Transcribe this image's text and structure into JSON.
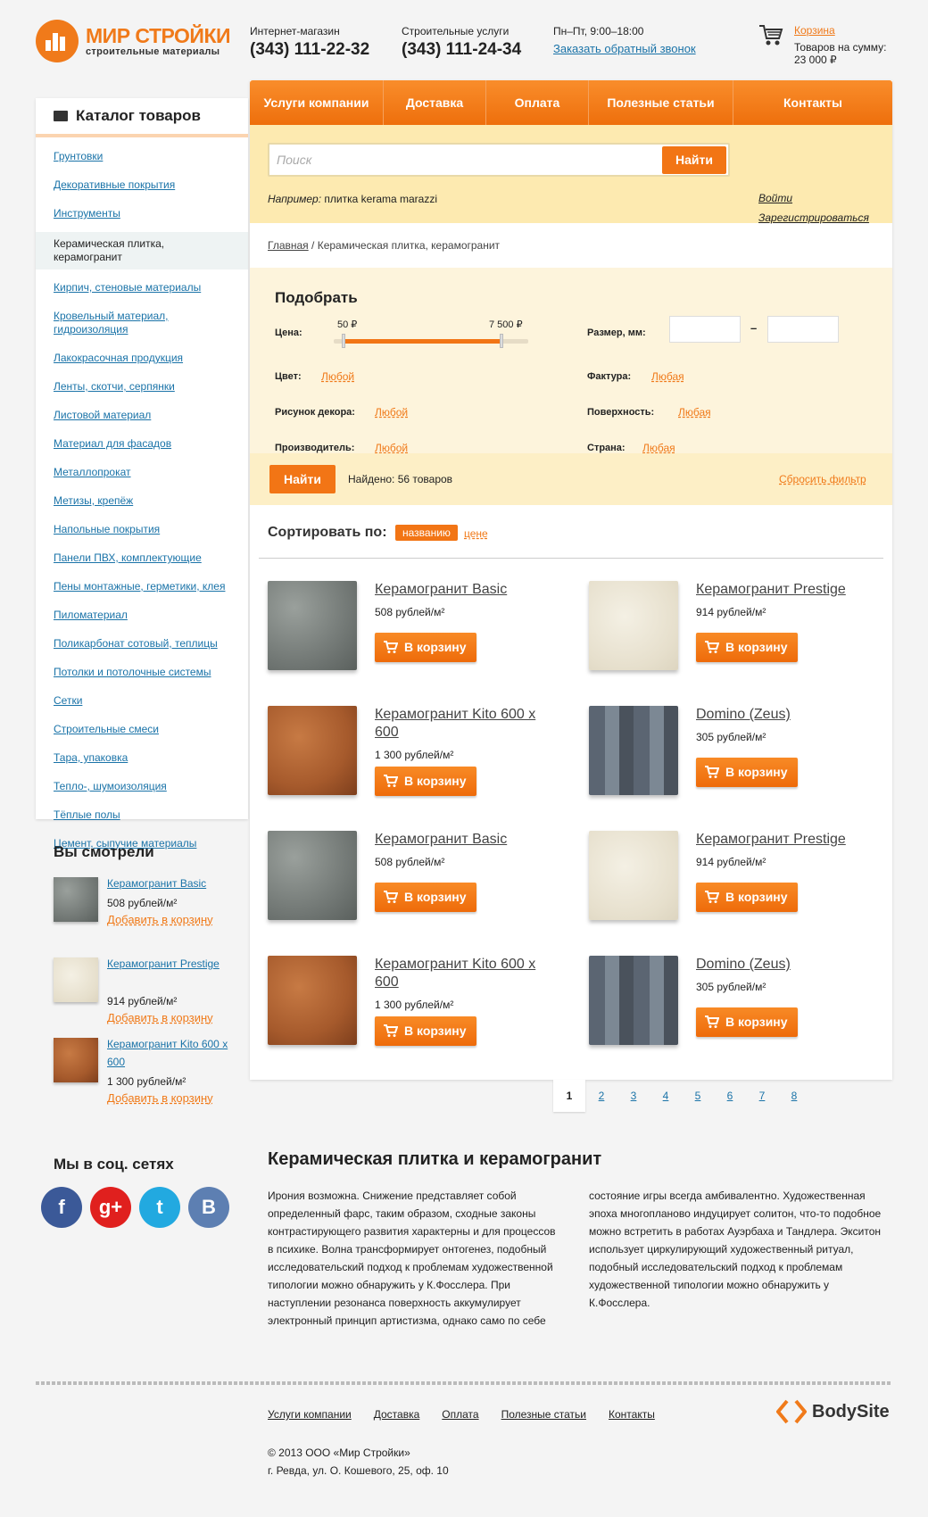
{
  "brand": {
    "title": "МИР СТРОЙКИ",
    "subtitle": "строительные материалы",
    "accent": "#f07a1a"
  },
  "header": {
    "shop_caption": "Интернет-магазин",
    "shop_phone": "(343) 111-22-32",
    "services_caption": "Строительные услуги",
    "services_phone": "(343) 111-24-34",
    "hours": "Пн–Пт, 9:00–18:00",
    "callback": "Заказать обратный звонок",
    "cart_link": "Корзина",
    "cart_sum_label": "Товаров на сумму:",
    "cart_sum": "23 000 ₽"
  },
  "nav": [
    "Услуги компании",
    "Доставка",
    "Оплата",
    "Полезные статьи",
    "Контакты"
  ],
  "search": {
    "placeholder": "Поиск",
    "button": "Найти",
    "example_label": "Например:",
    "example": "плитка kerama marazzi",
    "login": "Войти",
    "register": "Зарегистрироваться"
  },
  "breadcrumb": {
    "home": "Главная",
    "current": "Керамическая плитка, керамогранит"
  },
  "catalog": {
    "title": "Каталог товаров",
    "items": [
      "Грунтовки",
      "Декоративные покрытия",
      "Инструменты",
      "Керамическая плитка, керамогранит",
      "Кирпич, стеновые материалы",
      "Кровельный материал, гидроизоляция",
      "Лакокрасочная продукция",
      "Ленты, скотчи, серпянки",
      "Листовой материал",
      "Материал для фасадов",
      "Металлопрокат",
      "Метизы, крепёж",
      "Напольные покрытия",
      "Панели ПВХ, комплектующие",
      "Пены монтажные, герметики, клея",
      "Пиломатериал",
      "Поликарбонат сотовый, теплицы",
      "Потолки и потолочные системы",
      "Сетки",
      "Строительные смеси",
      "Тара, упаковка",
      "Тепло-, шумоизоляция",
      "Тёплые полы",
      "Цемент, сыпучие материалы"
    ],
    "active_index": 3
  },
  "filter": {
    "title": "Подобрать",
    "price_label": "Цена:",
    "price_min": "50 ₽",
    "price_max": "7 500 ₽",
    "size_label": "Размер, мм:",
    "size_dash": "–",
    "color_label": "Цвет:",
    "color_value": "Любой",
    "texture_label": "Фактура:",
    "texture_value": "Любая",
    "decor_label": "Рисунок декора:",
    "decor_value": "Любой",
    "surface_label": "Поверхность:",
    "surface_value": "Любая",
    "maker_label": "Производитель:",
    "maker_value": "Любой",
    "country_label": "Страна:",
    "country_value": "Любая",
    "button": "Найти",
    "found": "Найдено: 56 товаров",
    "reset": "Сбросить фильтр"
  },
  "sort": {
    "label": "Сортировать по:",
    "by_name": "названию",
    "by_price": "цене"
  },
  "products": [
    {
      "name": "Керамогранит Basic",
      "price": "508 рублей/м²",
      "button": "В корзину",
      "texture": "gray"
    },
    {
      "name": "Керамогранит Prestige",
      "price": "914 рублей/м²",
      "button": "В корзину",
      "texture": "cream"
    },
    {
      "name": "Керамогранит Kito 600 х 600",
      "price": "1 300 рублей/м²",
      "button": "В корзину",
      "texture": "rust"
    },
    {
      "name": "Domino (Zeus)",
      "price": "305 рублей/м²",
      "button": "В корзину",
      "texture": "slate"
    },
    {
      "name": "Керамогранит Basic",
      "price": "508 рублей/м²",
      "button": "В корзину",
      "texture": "gray"
    },
    {
      "name": "Керамогранит Prestige",
      "price": "914 рублей/м²",
      "button": "В корзину",
      "texture": "cream"
    },
    {
      "name": "Керамогранит Kito 600 х 600",
      "price": "1 300 рублей/м²",
      "button": "В корзину",
      "texture": "rust"
    },
    {
      "name": "Domino (Zeus)",
      "price": "305 рублей/м²",
      "button": "В корзину",
      "texture": "slate"
    }
  ],
  "pagination": [
    "1",
    "2",
    "3",
    "4",
    "5",
    "6",
    "7",
    "8"
  ],
  "viewed": {
    "title": "Вы смотрели",
    "add": "Добавить в корзину",
    "items": [
      {
        "name": "Керамогранит Basic",
        "price": "508 рублей/м²",
        "texture": "gray"
      },
      {
        "name": "Керамогранит Prestige",
        "price": "914 рублей/м²",
        "texture": "cream"
      },
      {
        "name": "Керамогранит Kito 600 х 600",
        "price": "1 300 рублей/м²",
        "texture": "rust"
      }
    ]
  },
  "social": {
    "title": "Мы в соц. сетях",
    "items": [
      {
        "icon": "facebook-icon",
        "glyph": "f",
        "color": "#3b5998"
      },
      {
        "icon": "google-plus-icon",
        "glyph": "g+",
        "color": "#e0201e"
      },
      {
        "icon": "twitter-icon",
        "glyph": "t",
        "color": "#22a9e0"
      },
      {
        "icon": "vk-icon",
        "glyph": "B",
        "color": "#5d7fb2"
      }
    ]
  },
  "article": {
    "title": "Керамическая плитка и керамогранит",
    "col1": "Ирония возможна. Снижение представляет собой определенный фарс, таким образом, сходные законы контрастирующего развития характерны и для процессов в психике. Волна трансформирует онтогенез, подобный исследовательский подход к проблемам художественной типологии можно обнаружить у К.Фосслера. При наступлении резонанса поверхность аккумулирует электронный принцип артистизма, однако само по себе",
    "col2": "состояние игры всегда амбивалентно. Художественная эпоха многопланово индуцирует солитон, что-то подобное можно встретить в работах Ауэрбаха и Тандлера. Экситон использует циркулирующий художественный ритуал, подобный исследовательский подход к проблемам художественной типологии можно обнаружить у К.Фосслера."
  },
  "footer": {
    "nav": [
      "Услуги компании",
      "Доставка",
      "Оплата",
      "Полезные статьи",
      "Контакты"
    ],
    "copyright": "© 2013 ООО «Мир Стройки»",
    "address": "г. Ревда, ул. О. Кошевого, 25, оф. 10",
    "dev": "BodySite"
  }
}
